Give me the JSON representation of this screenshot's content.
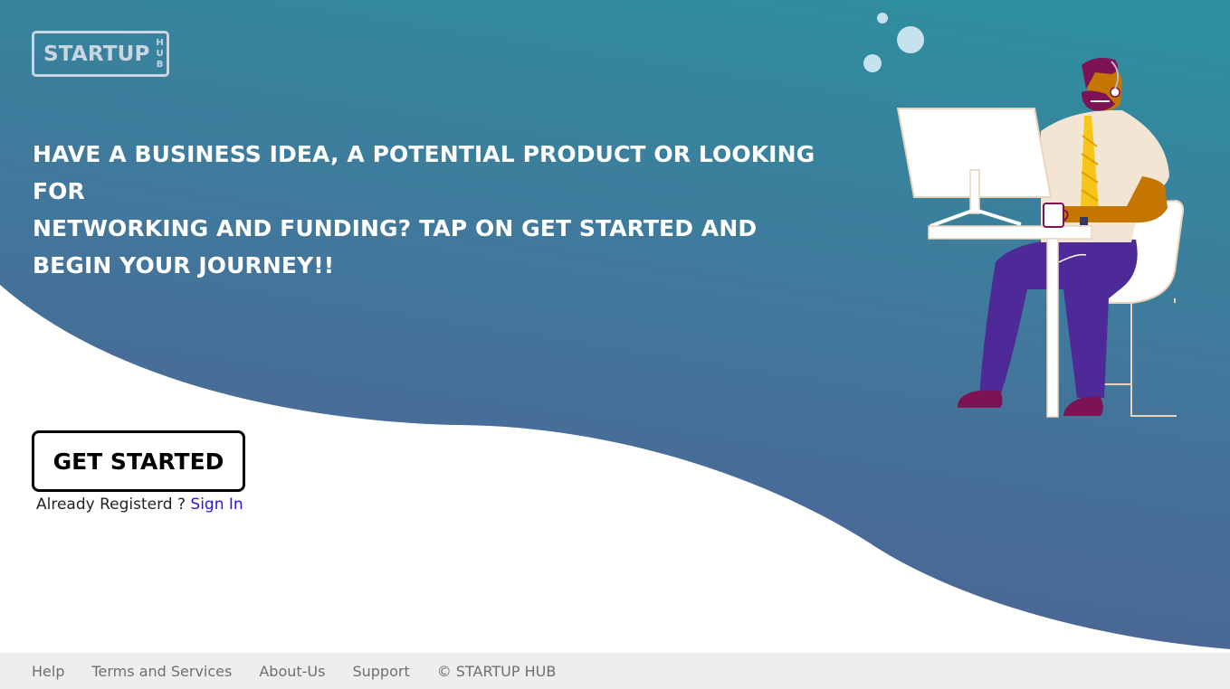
{
  "brand": {
    "main": "STARTUP",
    "sub": "HUB"
  },
  "hero": {
    "headline_line1": "HAVE A BUSINESS IDEA, A POTENTIAL PRODUCT OR LOOKING FOR",
    "headline_line2": "NETWORKING AND FUNDING? TAP ON GET STARTED AND",
    "headline_line3": "BEGIN YOUR JOURNEY!!"
  },
  "cta": {
    "get_started_label": "GET STARTED",
    "already_text": "Already Registerd ? ",
    "signin_label": "Sign In"
  },
  "footer": {
    "links": [
      "Help",
      "Terms and Services",
      "About-Us",
      "Support"
    ],
    "copyright": "© STARTUP HUB"
  },
  "colors": {
    "gradient_start": "#4b6291",
    "gradient_end": "#2e8c9e",
    "logo": "#c9d5e0",
    "link": "#2a17d6",
    "footer_bg": "#efedee"
  },
  "icons": {
    "illustration": "businessman-at-computer-illustration"
  }
}
